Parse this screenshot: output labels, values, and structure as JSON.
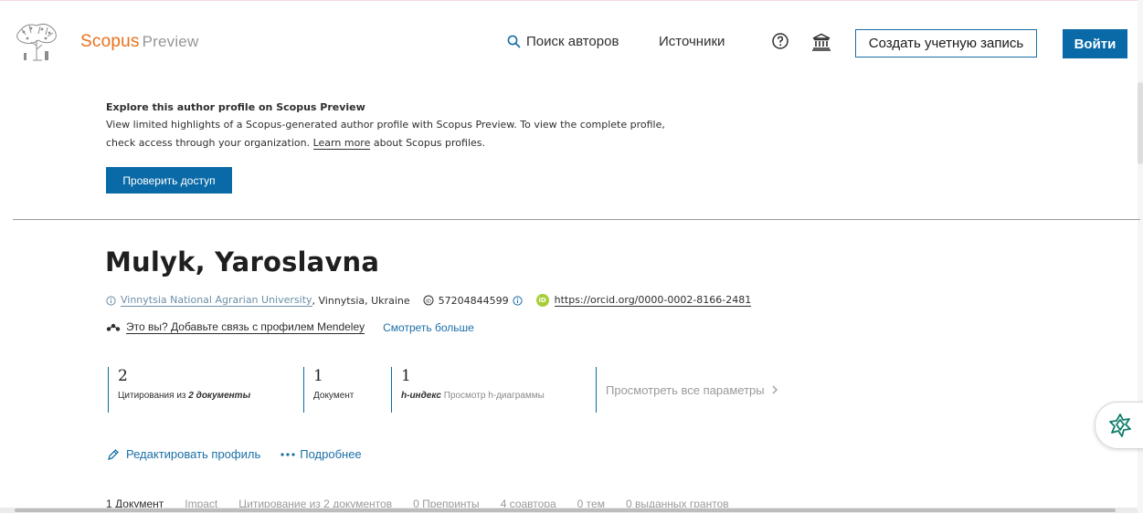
{
  "header": {
    "brand": "Scopus",
    "brand_sub": "Preview",
    "nav_search": "Поиск авторов",
    "nav_sources": "Источники",
    "create_account": "Создать учетную запись",
    "login": "Войти"
  },
  "banner": {
    "title": "Explore this author profile on Scopus Preview",
    "line1": "View limited highlights of a Scopus-generated author profile with Scopus Preview. To view the complete profile,",
    "line2_prefix": "check access through your organization.",
    "learn_more": "Learn more",
    "line2_suffix": "about Scopus profiles.",
    "check_access": "Проверить доступ"
  },
  "author": {
    "name": "Mulyk, Yaroslavna",
    "affiliation": "Vinnytsia National Agrarian University",
    "location": ", Vinnytsia, Ukraine",
    "scopus_id": "57204844599",
    "orcid_badge": "iD",
    "orcid": "https://orcid.org/0000-0002-8166-2481",
    "mendeley": "Это вы? Добавьте связь с профилем Mendeley",
    "see_more": "Смотреть больше"
  },
  "metrics": {
    "citations_value": "2",
    "citations_label": "Цитирования из ",
    "citations_docs": "2 документы",
    "documents_value": "1",
    "documents_label": "Документ",
    "h_value": "1",
    "h_label": "h-индекс",
    "h_view": "Просмотр h-диаграммы",
    "all_params": "Просмотреть все параметры"
  },
  "actions": {
    "edit_profile": "Редактировать профиль",
    "more": "Подробнее"
  },
  "tabs": [
    "1 Документ",
    "Impact",
    "Цитирование из 2 документов",
    "0 Препринты",
    "4 соавтора",
    "0 тем",
    "0 выданных грантов"
  ],
  "colors": {
    "brand_orange": "#e9711c",
    "primary_blue": "#0a6aa7",
    "orcid_green": "#a6ce39",
    "assistant_green": "#0c7d68"
  }
}
